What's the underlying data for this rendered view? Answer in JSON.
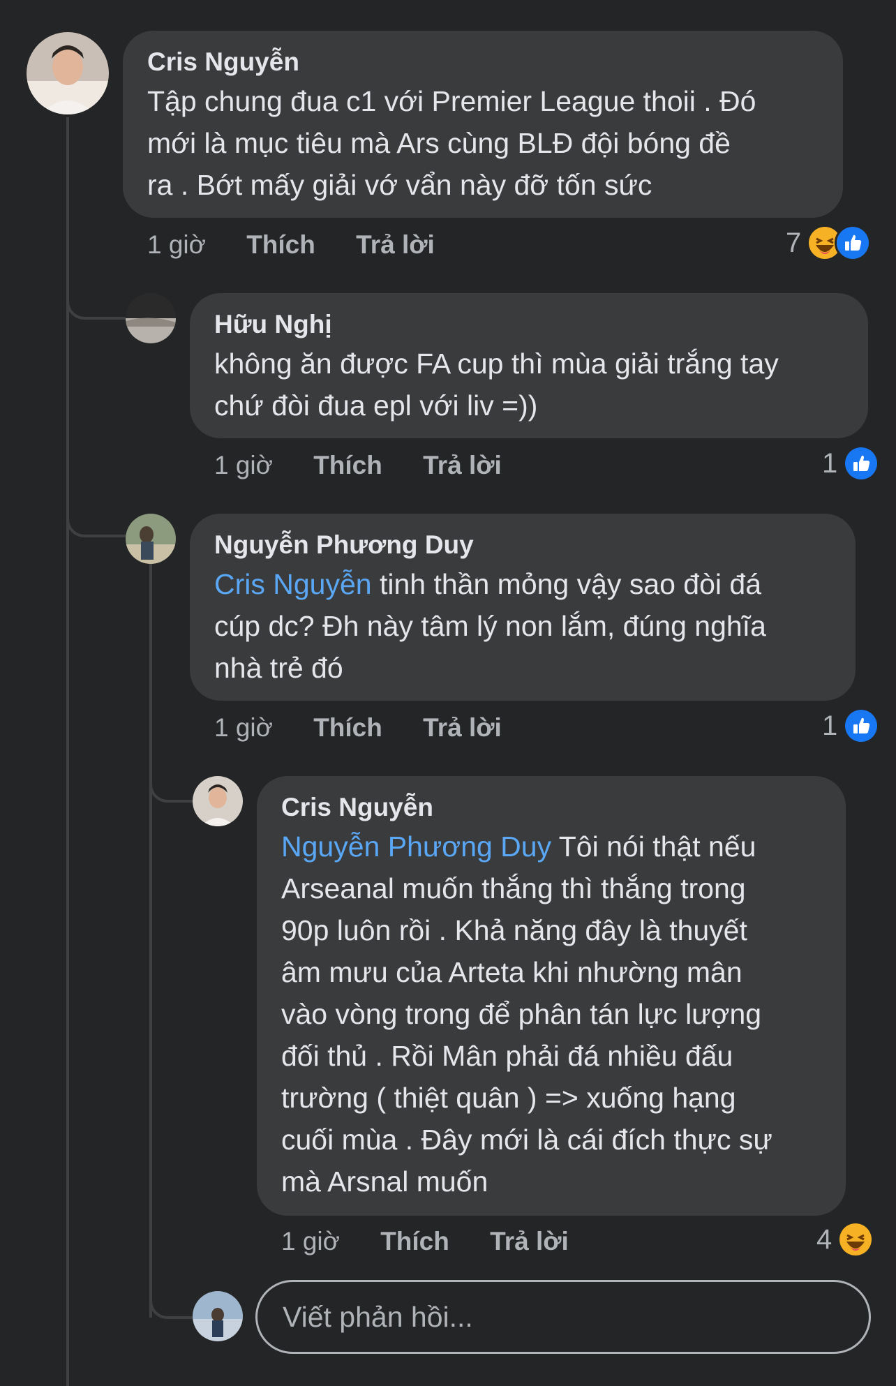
{
  "comments": [
    {
      "author": "Cris Nguyễn",
      "mention": "",
      "lines": [
        "Tập chung đua c1 với Premier League thoii . Đó",
        "mới là mục tiêu mà Ars cùng BLĐ đội bóng đề",
        "ra . Bớt mấy giải vớ vẩn này đỡ tốn sức"
      ],
      "time": "1 giờ",
      "like_label": "Thích",
      "reply_label": "Trả lời",
      "reaction_count": "7",
      "reactions": [
        "haha",
        "like"
      ]
    },
    {
      "author": "Hữu Nghị",
      "mention": "",
      "lines": [
        "không ăn được FA cup thì mùa giải trắng tay",
        "chứ đòi đua epl với liv =))"
      ],
      "time": "1 giờ",
      "like_label": "Thích",
      "reply_label": "Trả lời",
      "reaction_count": "1",
      "reactions": [
        "like"
      ]
    },
    {
      "author": "Nguyễn Phương Duy",
      "mention": "Cris Nguyễn",
      "first_line_rest": " tinh thần mỏng vậy sao đòi đá",
      "lines": [
        "cúp dc? Đh này tâm lý non lắm, đúng nghĩa",
        "nhà trẻ đó"
      ],
      "time": "1 giờ",
      "like_label": "Thích",
      "reply_label": "Trả lời",
      "reaction_count": "1",
      "reactions": [
        "like"
      ]
    },
    {
      "author": "Cris Nguyễn",
      "mention": "Nguyễn Phương Duy",
      "first_line_rest": " Tôi nói thật nếu",
      "lines": [
        "Arseanal muốn thắng thì thắng trong",
        "90p luôn rồi . Khả năng đây là thuyết",
        "âm mưu của Arteta khi nhường mân",
        "vào vòng trong để phân tán lực lượng",
        "đối thủ . Rồi Mân phải đá nhiều đấu",
        "trường ( thiệt quân ) => xuống hạng",
        "cuối mùa . Đây mới là cái đích thực sự",
        "mà Arsnal muốn"
      ],
      "time": "1 giờ",
      "like_label": "Thích",
      "reply_label": "Trả lời",
      "reaction_count": "4",
      "reactions": [
        "haha"
      ]
    }
  ],
  "reply_input": {
    "placeholder": "Viết phản hồi..."
  },
  "colors": {
    "background": "#242526",
    "bubble": "#3a3b3c",
    "mention": "#5aa7f5",
    "like": "#1877f2",
    "haha": "#f7b125"
  }
}
